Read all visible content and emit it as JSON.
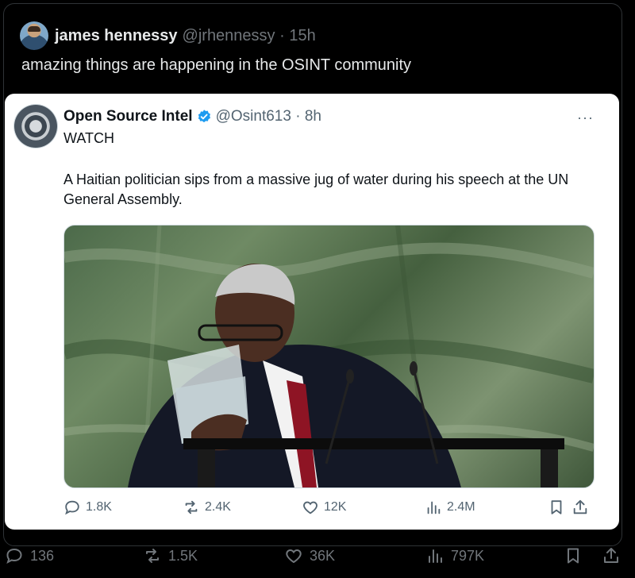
{
  "outer_tweet": {
    "author_name": "james hennessy",
    "author_meta": "@jrhennessy · 15h",
    "text": "amazing things are happening in the OSINT community",
    "stats": {
      "replies": "136",
      "reposts": "1.5K",
      "likes": "36K",
      "views": "797K"
    }
  },
  "quoted_tweet": {
    "author_name": "Open Source Intel",
    "author_meta": "@Osint613 · 8h",
    "more": "···",
    "line1": "WATCH",
    "body": "A Haitian politician sips from a massive jug of water during his speech at the UN General Assembly.",
    "stats": {
      "replies": "1.8K",
      "reposts": "2.4K",
      "likes": "12K",
      "views": "2.4M"
    }
  },
  "colors": {
    "verified": "#1d9bf0",
    "background": "#000000",
    "card": "#ffffff"
  },
  "icons": [
    "reply-icon",
    "repost-icon",
    "like-icon",
    "views-icon",
    "bookmark-icon",
    "share-icon",
    "verified-icon",
    "more-icon"
  ]
}
